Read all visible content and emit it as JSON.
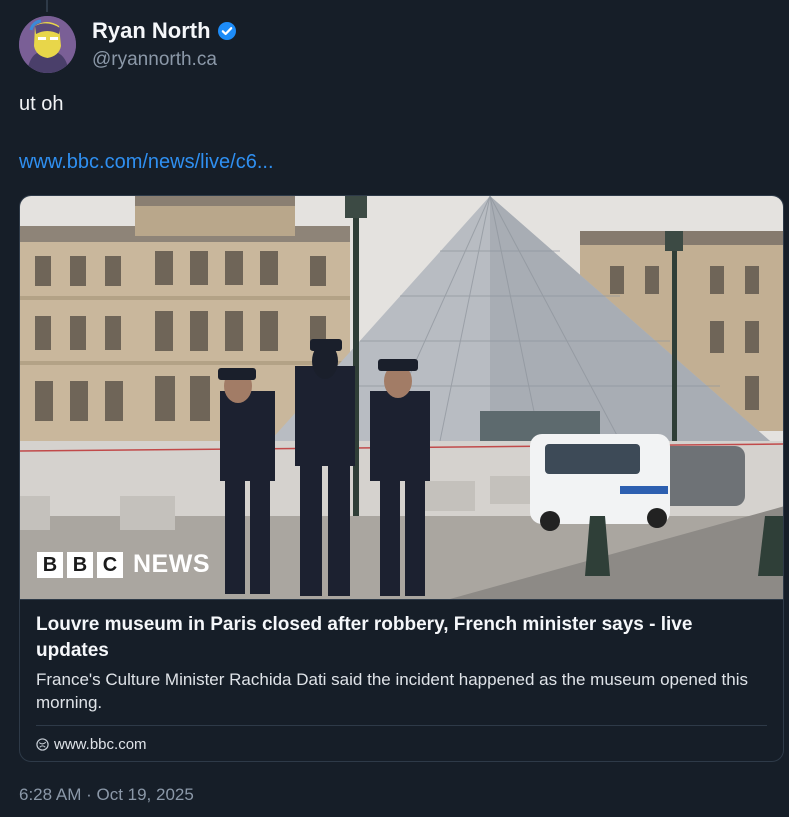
{
  "author": {
    "display_name": "Ryan North",
    "handle": "@ryannorth.ca",
    "verified": true,
    "verified_color": "#1d8cf8",
    "avatar_icon": "avatar-image"
  },
  "post": {
    "text": "ut oh",
    "link_text": "www.bbc.com/news/live/c6...",
    "timestamp": "6:28 AM · Oct 19, 2025"
  },
  "card": {
    "image_alt": "Police officers standing in front of the Louvre pyramid",
    "image_logo": {
      "letters": [
        "B",
        "B",
        "C"
      ],
      "word": "NEWS"
    },
    "title": "Louvre museum in Paris closed after robbery, French minister says - live updates",
    "description": "France's Culture Minister Rachida Dati said the incident happened as the museum opened this morning.",
    "source_domain": "www.bbc.com",
    "source_icon": "globe-icon"
  },
  "colors": {
    "background": "#161e28",
    "link": "#2f8ff0",
    "muted": "#8b98a8",
    "border": "#2e3a48"
  }
}
